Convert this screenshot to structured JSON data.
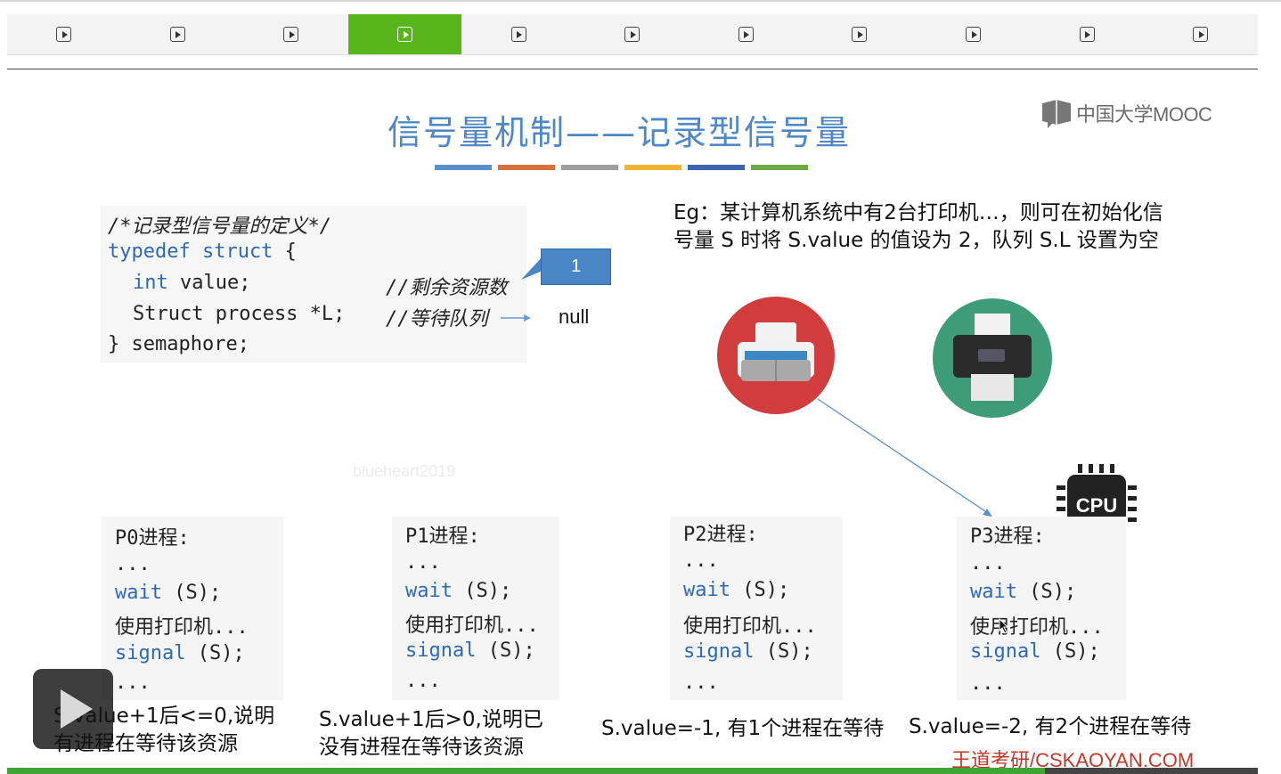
{
  "nav": {
    "tab_count": 11,
    "active_index": 3,
    "active_color": "#58b51b"
  },
  "slide": {
    "title": "信号量机制——记录型信号量",
    "bar_colors": [
      "#5b8fcc",
      "#d9703e",
      "#9e9e9e",
      "#efb430",
      "#3e64b0",
      "#6ea845"
    ],
    "logo": "中国大学MOOC",
    "code": {
      "line1": "/*记录型信号量的定义*/",
      "line2_kw": "typedef struct",
      "line2_rest": " {",
      "line3_kw": "int",
      "line3_rest": " value;",
      "line3_comment": "//剩余资源数",
      "line4": "Struct process *L;",
      "line4_comment": "//等待队列",
      "line5": "} semaphore;"
    },
    "callout_value": "1",
    "null_label": "null",
    "eg_text": "Eg：某计算机系统中有2台打印机…，则可在初始化信号量 S 时将 S.value 的值设为 2，队列 S.L 设置为空",
    "cpu_label": "CPU",
    "watermark": "blueheart2019",
    "processes": [
      {
        "title": "P0进程:",
        "dots1": "...",
        "wait_kw": "wait",
        "wait_rest": " (S);",
        "use": "使用打印机...",
        "signal_kw": "signal",
        "signal_rest": " (S);",
        "dots2": "..."
      },
      {
        "title": "P1进程:",
        "dots1": "...",
        "wait_kw": "wait",
        "wait_rest": " (S);",
        "use": "使用打印机...",
        "signal_kw": "signal",
        "signal_rest": " (S);",
        "dots2": "..."
      },
      {
        "title": "P2进程:",
        "dots1": "...",
        "wait_kw": "wait",
        "wait_rest": " (S);",
        "use": "使用打印机...",
        "signal_kw": "signal",
        "signal_rest": " (S);",
        "dots2": "..."
      },
      {
        "title": "P3进程:",
        "dots1": "...",
        "wait_kw": "wait",
        "wait_rest": " (S);",
        "use": "使用打印机...",
        "signal_kw": "signal",
        "signal_rest": " (S);",
        "dots2": "..."
      }
    ],
    "captions": [
      "S.value+1后<=0,说明\n有进程在等待该资源",
      "S.value+1后>0,说明已\n没有进程在等待该资源",
      "S.value=-1, 有1个进程在等待",
      "S.value=-2, 有2个进程在等待"
    ],
    "brand": "王道考研/CSKAOYAN.COM"
  },
  "player": {
    "progress": 0.83,
    "progress_color": "#3fa535"
  }
}
